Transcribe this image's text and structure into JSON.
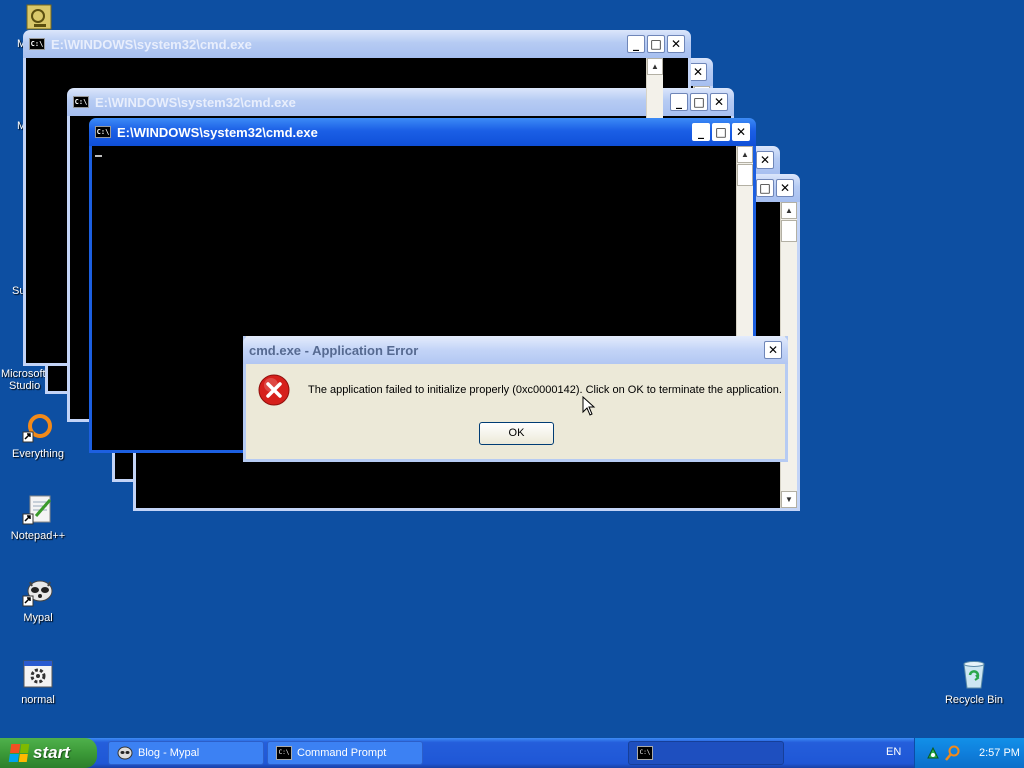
{
  "desktop": {
    "icons": [
      {
        "label": "Everything"
      },
      {
        "label": "Notepad++"
      },
      {
        "label": "Mypal"
      },
      {
        "label": "normal"
      },
      {
        "label": "Recycle Bin"
      }
    ],
    "partial_labels": [
      "M",
      "M",
      "Su",
      "Microsoft",
      "Studio"
    ]
  },
  "windows": {
    "title": "E:\\WINDOWS\\system32\\cmd.exe",
    "icon_text": "C:\\",
    "min_glyph": "_",
    "max_glyph": "□",
    "close_glyph": "✕"
  },
  "dialog": {
    "title": "cmd.exe - Application Error",
    "message": "The application failed to initialize properly (0xc0000142). Click on OK to terminate the application.",
    "ok_label": "OK",
    "close_glyph": "✕",
    "icon": "error-icon"
  },
  "taskbar": {
    "start_label": "start",
    "tasks": [
      {
        "label": "Blog - Mypal"
      },
      {
        "label": "Command Prompt"
      },
      {
        "label": ""
      }
    ],
    "language": "EN",
    "clock": "2:57 PM"
  },
  "colors": {
    "desktop": "#0d4fa2",
    "active_title": "#1b5fe6",
    "error_red": "#d6201c",
    "start_green": "#3c9a38"
  }
}
